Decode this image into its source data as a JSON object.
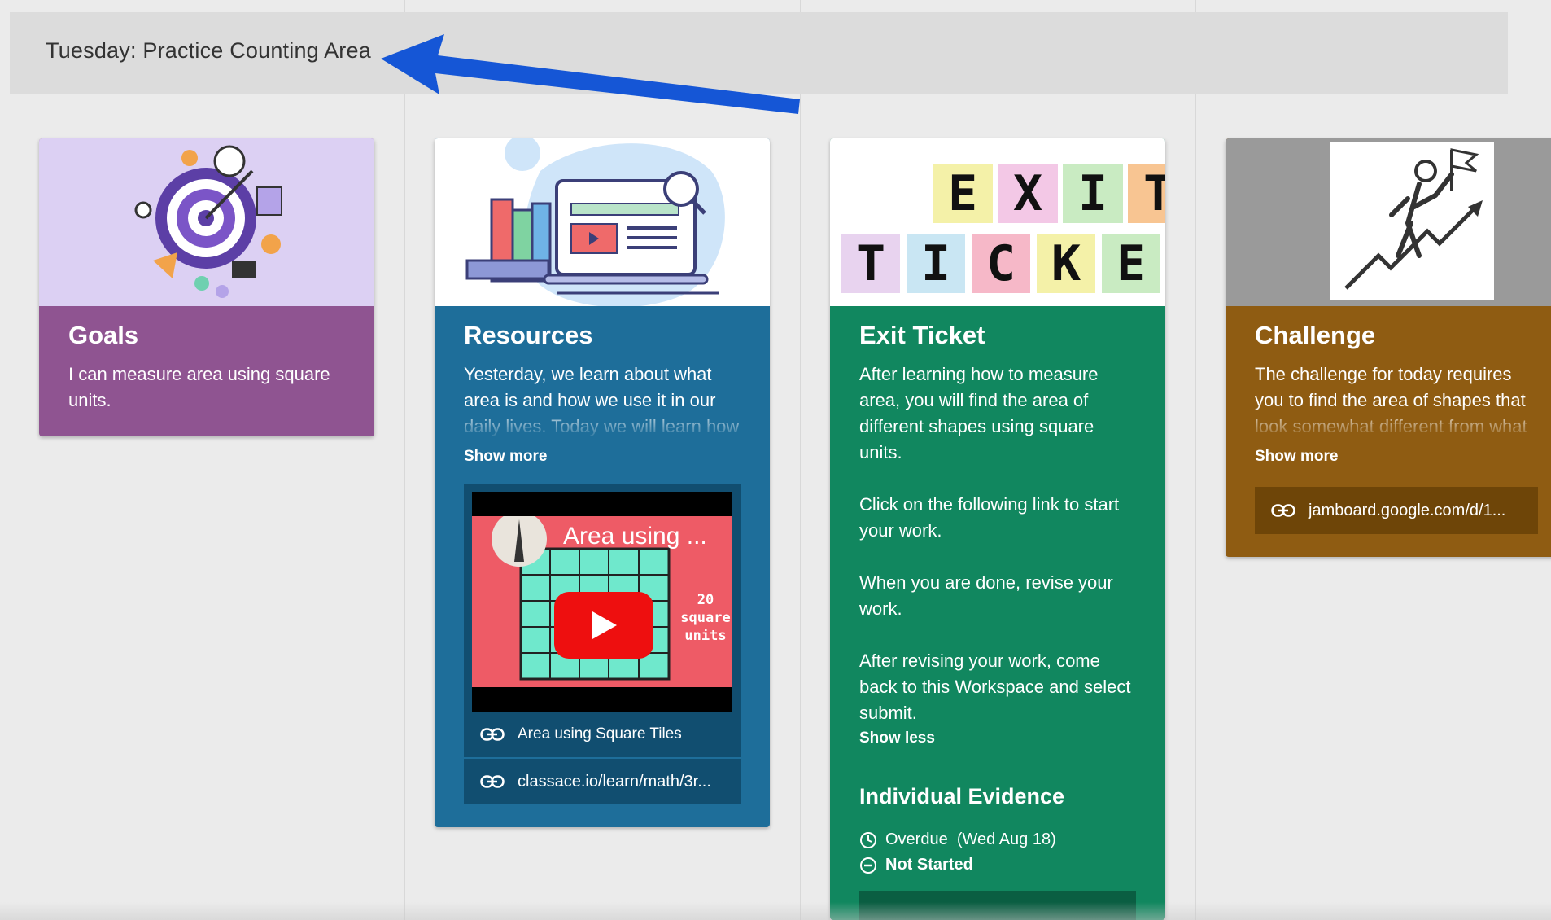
{
  "header": {
    "title": "Tuesday: Practice Counting Area"
  },
  "cards": {
    "goals": {
      "title": "Goals",
      "text": "I can measure area using square units."
    },
    "resources": {
      "title": "Resources",
      "text": "Yesterday, we learn about what area is and how we use it in our daily lives. Today we will learn how to measure it using square",
      "show_more": "Show more",
      "video_title": "Area using ...",
      "video_caption_1": "20",
      "video_caption_2": "square",
      "video_caption_3": "units",
      "link1": "Area using Square Tiles",
      "link2": "classace.io/learn/math/3r..."
    },
    "exit": {
      "title": "Exit Ticket",
      "img_row1": [
        "E",
        "X",
        "I",
        "T"
      ],
      "img_row2": [
        "T",
        "I",
        "C",
        "K",
        "E"
      ],
      "p1": "After learning how to measure area, you will find the area of different shapes using square units.",
      "p2": "Click on the following link to start your work.",
      "p3": "When you are done, revise your work.",
      "p4": "After revising your work, come back to this Workspace and select submit.",
      "show_less": "Show less",
      "evidence_title": "Individual Evidence",
      "due": "Overdue  (Wed Aug 18)",
      "status": "Not Started"
    },
    "challenge": {
      "title": "Challenge",
      "text": "The challenge for today requires you to find the area of shapes that look somewhat different from what we have been doing",
      "show_more": "Show more",
      "link": "jamboard.google.com/d/1..."
    }
  },
  "colors": {
    "goals": "#8f5491",
    "resources": "#1e6e9a",
    "exit": "#11875f",
    "challenge": "#8f5c12",
    "arrow": "#1556d6"
  }
}
